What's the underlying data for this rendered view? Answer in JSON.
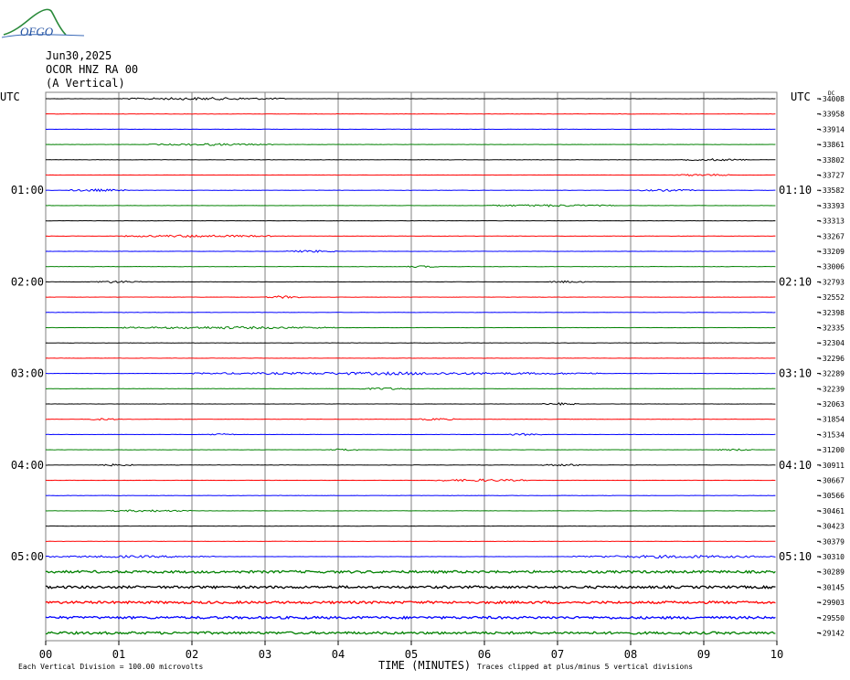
{
  "header": {
    "logo_text": "OFGO",
    "date": "Jun30,2025",
    "station": "OCOR HNZ RA 00",
    "component": "(A Vertical)"
  },
  "footer": {
    "scale_note": "Each Vertical Division =  100.00 microvolts",
    "x_title": "TIME (MINUTES)",
    "clip_note": "Traces clipped at plus/minus 5 vertical divisions"
  },
  "chart_data": {
    "type": "line",
    "title": "",
    "xlabel": "TIME (MINUTES)",
    "xlim": [
      0,
      10
    ],
    "x_ticks": [
      "00",
      "01",
      "02",
      "03",
      "04",
      "05",
      "06",
      "07",
      "08",
      "09",
      "10"
    ],
    "utc_label": "UTC",
    "left_time_labels": [
      {
        "row": 0,
        "label": "UTC"
      },
      {
        "row": 6,
        "label": "01:00"
      },
      {
        "row": 12,
        "label": "02:00"
      },
      {
        "row": 18,
        "label": "03:00"
      },
      {
        "row": 24,
        "label": "04:00"
      },
      {
        "row": 30,
        "label": "05:00"
      }
    ],
    "right_time_labels": [
      {
        "row": 0,
        "label": "UTC"
      },
      {
        "row": 6,
        "label": "01:10"
      },
      {
        "row": 12,
        "label": "02:10"
      },
      {
        "row": 18,
        "label": "03:10"
      },
      {
        "row": 24,
        "label": "04:10"
      },
      {
        "row": 30,
        "label": "05:10"
      }
    ],
    "trace_colors": [
      "#000000",
      "#ff0000",
      "#0000ff",
      "#008000"
    ],
    "grid_color": "#808080",
    "dc_offsets": [
      -34008,
      -33958,
      -33914,
      -33861,
      -33802,
      -33727,
      -33582,
      -33393,
      -33313,
      -33267,
      -33209,
      -33006,
      -32793,
      -32552,
      -32398,
      -32335,
      -32304,
      -32296,
      -32289,
      -32239,
      -32063,
      -31854,
      -31534,
      -31200,
      -30911,
      -30667,
      -30566,
      -30461,
      -30423,
      -30379,
      -30310,
      -30289,
      -30145,
      -29903,
      -29550,
      -29142
    ],
    "events": [
      {
        "row": 0,
        "start": 1.0,
        "end": 3.3,
        "amp": 1.5
      },
      {
        "row": 3,
        "start": 1.4,
        "end": 3.1,
        "amp": 1.2
      },
      {
        "row": 4,
        "start": 8.7,
        "end": 9.6,
        "amp": 1.2
      },
      {
        "row": 5,
        "start": 8.6,
        "end": 9.4,
        "amp": 1.2
      },
      {
        "row": 6,
        "start": 0.3,
        "end": 1.1,
        "amp": 1.4
      },
      {
        "row": 6,
        "start": 8.1,
        "end": 8.9,
        "amp": 1.2
      },
      {
        "row": 7,
        "start": 6.0,
        "end": 7.8,
        "amp": 1.2
      },
      {
        "row": 9,
        "start": 1.0,
        "end": 3.1,
        "amp": 1.4
      },
      {
        "row": 10,
        "start": 3.3,
        "end": 4.0,
        "amp": 1.3
      },
      {
        "row": 11,
        "start": 4.9,
        "end": 5.4,
        "amp": 1.1
      },
      {
        "row": 12,
        "start": 0.6,
        "end": 1.3,
        "amp": 1.3
      },
      {
        "row": 12,
        "start": 6.9,
        "end": 7.4,
        "amp": 1.2
      },
      {
        "row": 13,
        "start": 3.0,
        "end": 3.5,
        "amp": 1.5
      },
      {
        "row": 15,
        "start": 1.0,
        "end": 4.0,
        "amp": 1.4
      },
      {
        "row": 18,
        "start": 2.0,
        "end": 7.6,
        "amp": 1.6
      },
      {
        "row": 19,
        "start": 4.3,
        "end": 5.0,
        "amp": 1.3
      },
      {
        "row": 20,
        "start": 6.8,
        "end": 7.3,
        "amp": 1.2
      },
      {
        "row": 21,
        "start": 0.6,
        "end": 1.0,
        "amp": 1.2
      },
      {
        "row": 21,
        "start": 5.1,
        "end": 5.6,
        "amp": 1.3
      },
      {
        "row": 22,
        "start": 2.2,
        "end": 2.6,
        "amp": 1.1
      },
      {
        "row": 22,
        "start": 6.3,
        "end": 6.8,
        "amp": 1.2
      },
      {
        "row": 23,
        "start": 3.9,
        "end": 4.3,
        "amp": 1.3
      },
      {
        "row": 23,
        "start": 9.2,
        "end": 9.7,
        "amp": 1.1
      },
      {
        "row": 24,
        "start": 0.7,
        "end": 1.2,
        "amp": 1.2
      },
      {
        "row": 24,
        "start": 6.8,
        "end": 7.4,
        "amp": 1.2
      },
      {
        "row": 25,
        "start": 5.3,
        "end": 6.6,
        "amp": 1.4
      },
      {
        "row": 27,
        "start": 0.8,
        "end": 2.0,
        "amp": 1.2
      },
      {
        "row": 30,
        "start": 0.0,
        "end": 2.3,
        "amp": 1.3
      },
      {
        "row": 30,
        "start": 7.2,
        "end": 10.0,
        "amp": 1.6
      }
    ],
    "noisy_rows": [
      31,
      32,
      33,
      34,
      35
    ]
  }
}
